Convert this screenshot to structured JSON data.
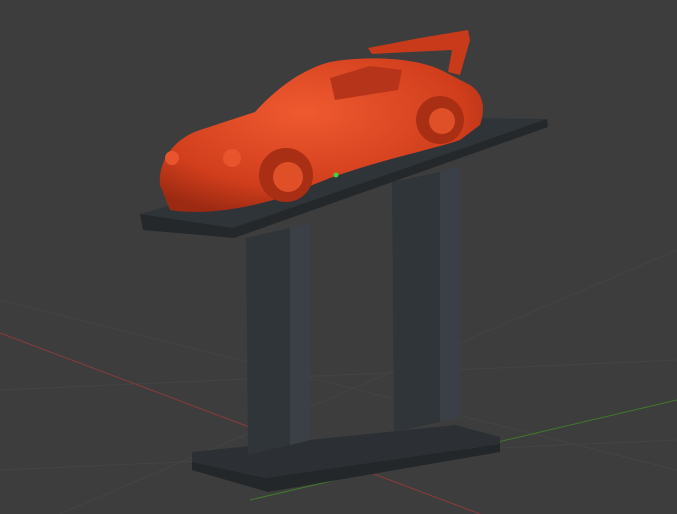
{
  "viewport": {
    "background": "#3d3d3d",
    "grid_color": "#454545",
    "x_axis_color": "#8a3a3a",
    "y_axis_color": "#3f7a2a",
    "origin_marker_color": "#3fd13f"
  },
  "scene": {
    "model_color": "#d9421e",
    "stand_color": "#2e3236",
    "stand_highlight": "#3c4247"
  }
}
